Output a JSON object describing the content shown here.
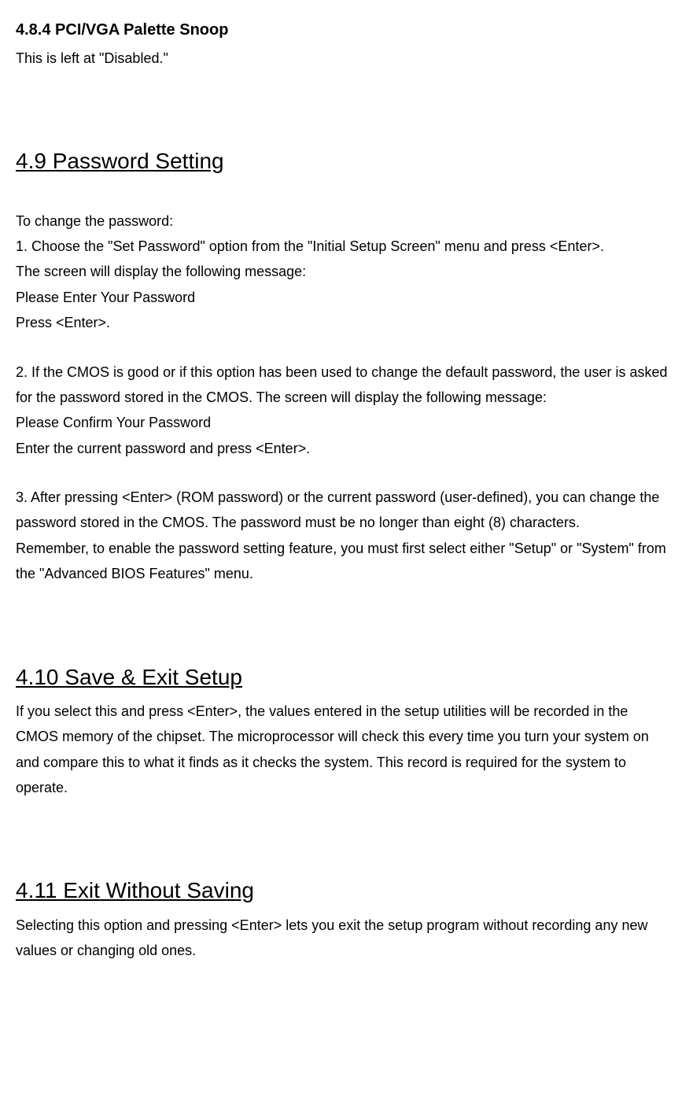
{
  "section_484": {
    "title": "4.8.4 PCI/VGA Palette Snoop",
    "text": "This is left at \"Disabled.\""
  },
  "section_49": {
    "title": "4.9 Password Setting",
    "intro": "To change the password:",
    "step1a": "1. Choose the \"Set Password\" option from the \"Initial Setup Screen\" menu and press <Enter>.",
    "step1b": "The screen will display the following message:",
    "step1c": "Please Enter Your Password",
    "step1d": "Press <Enter>.",
    "step2a": "2. If the CMOS is good or if this option has been used to change the default password, the user is asked for the password stored in the CMOS. The screen will display the following message:",
    "step2b": "Please Confirm Your Password",
    "step2c": "Enter the current password and press <Enter>.",
    "step3a": "3. After pressing <Enter> (ROM password) or the current password (user-defined), you can change the password stored in the CMOS. The password must be no longer than eight (8) characters.",
    "step3b": "Remember, to enable the password setting feature, you must first select either \"Setup\" or \"System\" from the \"Advanced BIOS Features\" menu."
  },
  "section_410": {
    "title": "4.10 Save & Exit Setup",
    "text": "If you select this and press <Enter>, the values entered in the setup utilities will be recorded in the CMOS memory of the chipset. The microprocessor will check this every time you turn your system on and compare this to what it finds as it checks the system. This record is required for the system to operate."
  },
  "section_411": {
    "title": "4.11 Exit Without Saving",
    "text": "Selecting this option and pressing <Enter> lets you exit the setup program without recording any new values or changing old ones."
  }
}
